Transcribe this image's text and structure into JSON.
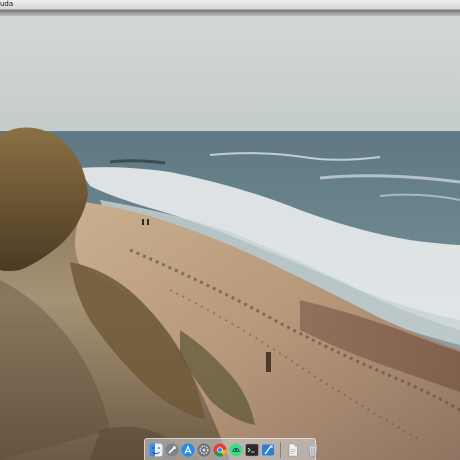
{
  "menubar": {
    "app_name": "uda"
  },
  "dock": {
    "apps": [
      {
        "icon": "finder-icon"
      },
      {
        "icon": "launchpad-icon"
      },
      {
        "icon": "app-store-icon"
      },
      {
        "icon": "system-preferences-icon"
      },
      {
        "icon": "chrome-icon"
      },
      {
        "icon": "android-studio-icon"
      },
      {
        "icon": "terminal-icon"
      },
      {
        "icon": "xcode-icon"
      }
    ],
    "trailing": [
      {
        "icon": "document-icon"
      },
      {
        "icon": "trash-icon"
      }
    ]
  }
}
